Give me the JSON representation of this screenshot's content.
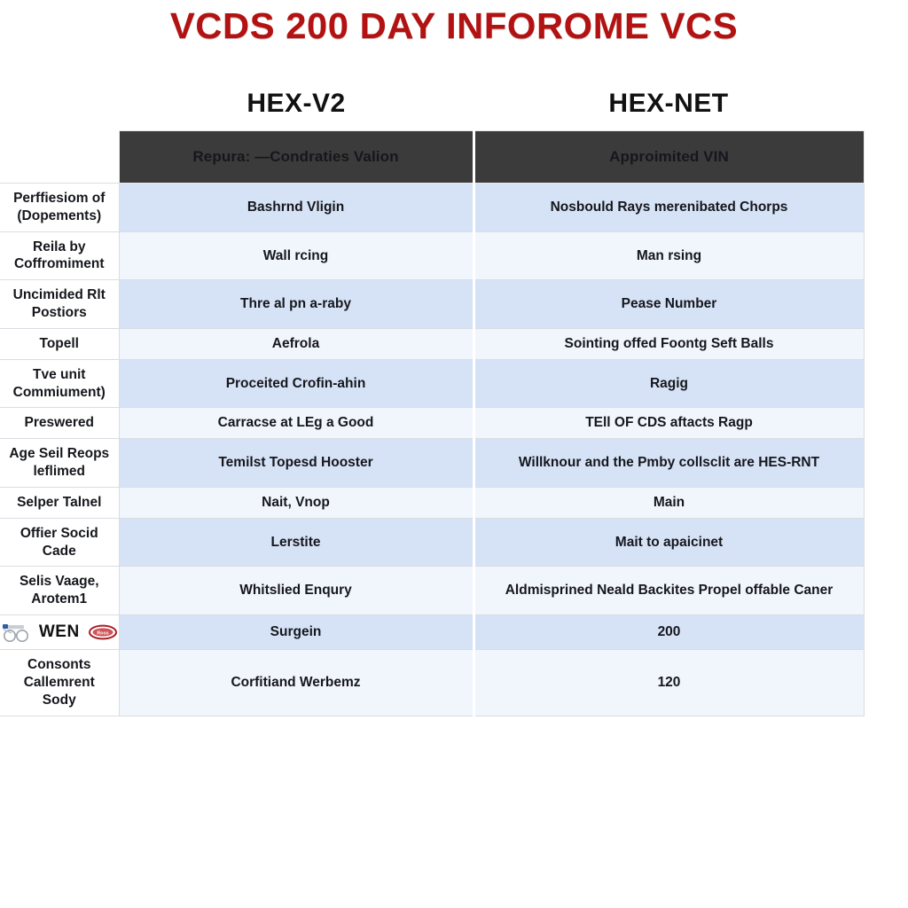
{
  "title": "VCDS 200 DAY INFOROME VCS",
  "colors": {
    "title_red": "#b31212",
    "header_dark": "#3b3b3b",
    "row_odd": "#d6e3f7",
    "row_even": "#f1f5fc",
    "grid_line": "#d9dde3"
  },
  "column_captions": {
    "left": "HEX-V2",
    "right": "HEX-NET"
  },
  "table": {
    "headers": {
      "corner": "",
      "hex_v2": "Repura: —Condraties Valion",
      "hex_net": "Approimited VIN"
    },
    "rows": [
      {
        "label": "Perffiesiom of (Dopements)",
        "hex_v2": "Bashrnd Vligin",
        "hex_net": "Nosbould Rays merenibated Chorps"
      },
      {
        "label": "Reila by Coffromiment",
        "hex_v2": "Wall rcing",
        "hex_net": "Man rsing"
      },
      {
        "label": "Uncimided Rlt Postiors",
        "hex_v2": "Thre al pn a-raby",
        "hex_net": "Pease Number"
      },
      {
        "label": "Topell",
        "hex_v2": "Aefrola",
        "hex_net": "Sointing offed Foontg Seft Balls"
      },
      {
        "label": "Tve unit Commiument)",
        "hex_v2": "Proceited Crofin-ahin",
        "hex_net": "Ragig"
      },
      {
        "label": "Preswered",
        "hex_v2": "Carracse at LEg a Good",
        "hex_net": "TEll OF CDS aftacts Ragp"
      },
      {
        "label": "Age Seil Reops leflimed",
        "hex_v2": "Temilst Topesd Hooster",
        "hex_net": "Willknour and the Pmby collsclit are HES-RNT"
      },
      {
        "label": "Selper Talnel",
        "hex_v2": "Nait, Vnop",
        "hex_net": "Main"
      },
      {
        "label": "Offier Socid Cade",
        "hex_v2": "Lerstite",
        "hex_net": "Mait to apaicinet"
      },
      {
        "label": "Selis Vaage, Arotem1",
        "hex_v2": "Whitslied Enqury",
        "hex_net": "Aldmisprined Neald Backites Propel offable Caner"
      },
      {
        "label": "WEN",
        "label_has_logos": true,
        "hex_v2": "Surgein",
        "hex_net": "200"
      },
      {
        "label": "Consonts Callemrent Sody",
        "hex_v2": "Corfitiand Werbemz",
        "hex_net": "120"
      }
    ]
  },
  "icons": {
    "left_logo": "glasses-logo-icon",
    "right_logo": "red-oval-logo-icon"
  }
}
